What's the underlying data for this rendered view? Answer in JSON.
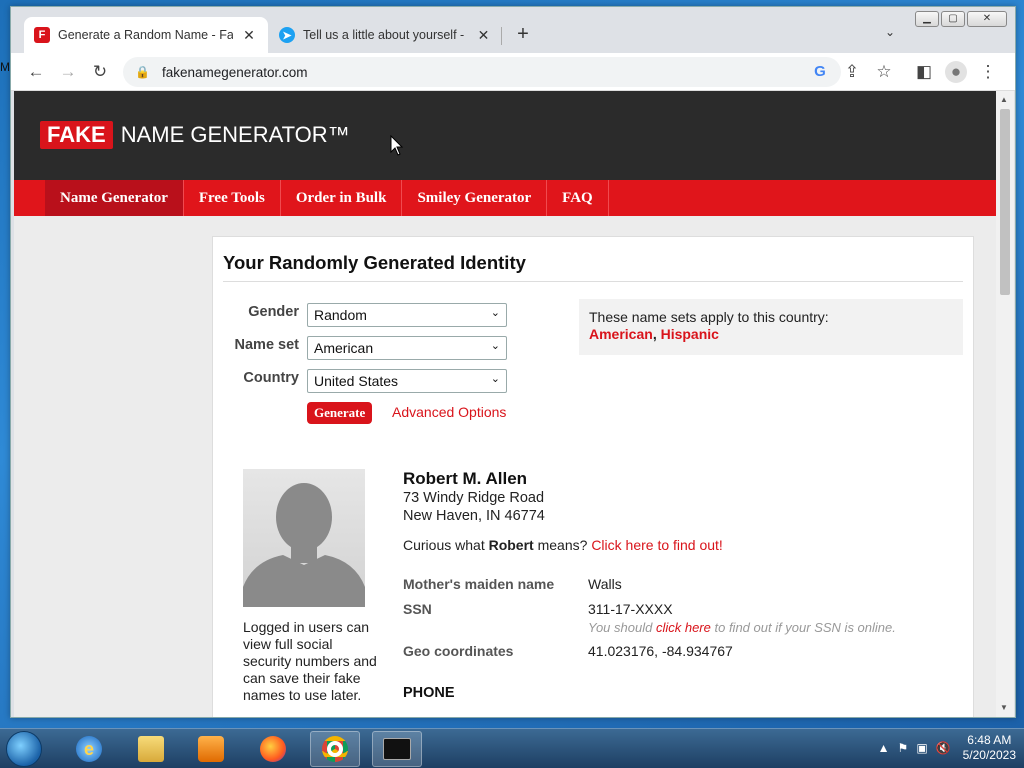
{
  "desktop": {
    "label": "M"
  },
  "browser": {
    "tabs": [
      {
        "title": "Generate a Random Name - Fake",
        "favicon": "F",
        "favicon_color": "#d9141b",
        "close": "✕",
        "active": true
      },
      {
        "title": "Tell us a little about yourself - Blu",
        "favicon": "➤",
        "favicon_color": "#1da1f2",
        "close": "✕",
        "active": false
      }
    ],
    "new_tab": "+",
    "tab_search": "⌄",
    "window_buttons": {
      "minimize": "▁",
      "maximize": "▢",
      "close": "✕"
    },
    "toolbar": {
      "back": "←",
      "forward": "→",
      "reload": "↻",
      "lock": "🔒",
      "url": "fakenamegenerator.com",
      "google": "G",
      "share": "⇪",
      "bookmark": "☆",
      "sidepanel": "◧",
      "profile": "●",
      "menu": "⋮"
    }
  },
  "site": {
    "logo_fake": "FAKE",
    "logo_rest": "NAME GENERATOR™",
    "nav": [
      "Name Generator",
      "Free Tools",
      "Order in Bulk",
      "Smiley Generator",
      "FAQ"
    ],
    "page_title": "Your Randomly Generated Identity",
    "form": {
      "gender_label": "Gender",
      "gender_value": "Random",
      "nameset_label": "Name set",
      "nameset_value": "American",
      "country_label": "Country",
      "country_value": "United States",
      "generate_label": "Generate",
      "advanced_label": "Advanced Options"
    },
    "nameset_info": {
      "text": "These name sets apply to this country:",
      "sets": [
        "American",
        "Hispanic"
      ]
    },
    "login_note": "Logged in users can view full social security numbers and can save their fake names to use later.",
    "identity": {
      "name": "Robert M. Allen",
      "address_line1": "73 Windy Ridge Road",
      "address_line2": "New Haven, IN 46774",
      "curious_prefix": "Curious what ",
      "curious_name": "Robert",
      "curious_suffix": " means? ",
      "curious_link": "Click here to find out!",
      "maiden_label": "Mother's maiden name",
      "maiden_value": "Walls",
      "ssn_label": "SSN",
      "ssn_value": "311-17-XXXX",
      "ssn_note_prefix": "You should ",
      "ssn_note_link": "click here",
      "ssn_note_suffix": " to find out if your SSN is online.",
      "geo_label": "Geo coordinates",
      "geo_value": "41.023176, -84.934767",
      "phone_heading": "PHONE"
    }
  },
  "taskbar": {
    "apps": [
      "start-button",
      "internet-explorer",
      "file-explorer",
      "media-player",
      "firefox",
      "chrome",
      "command-prompt"
    ],
    "clock_time": "6:48 AM",
    "clock_date": "5/20/2023"
  }
}
